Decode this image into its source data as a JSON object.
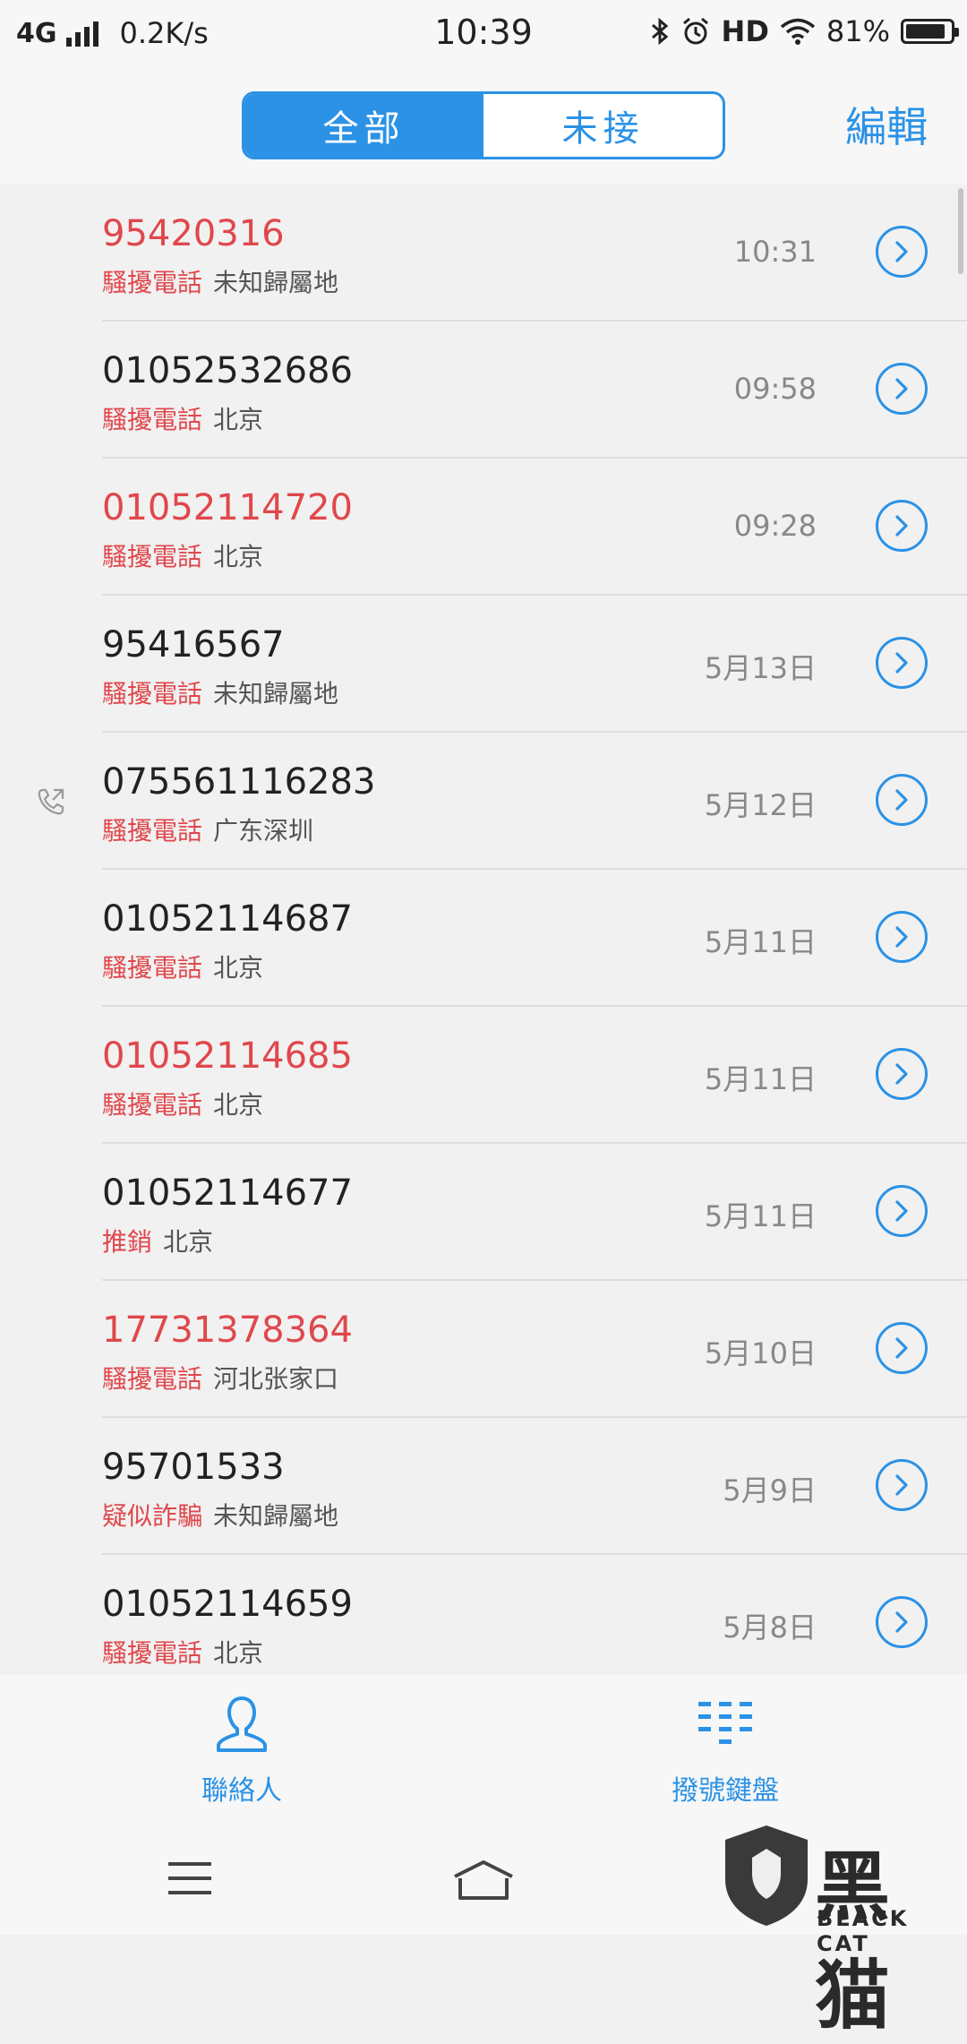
{
  "status_bar": {
    "network": "4G",
    "speed": "0.2K/s",
    "time": "10:39",
    "hd": "HD",
    "battery": "81%"
  },
  "header": {
    "tabs": [
      {
        "label": "全部",
        "active": true
      },
      {
        "label": "未接",
        "active": false
      }
    ],
    "edit_label": "編輯"
  },
  "calls": [
    {
      "number": "95420316",
      "missed": true,
      "tag": "騷擾電話",
      "location": "未知歸屬地",
      "time": "10:31",
      "outgoing": false
    },
    {
      "number": "01052532686",
      "missed": false,
      "tag": "騷擾電話",
      "location": "北京",
      "time": "09:58",
      "outgoing": false
    },
    {
      "number": "01052114720",
      "missed": true,
      "tag": "騷擾電話",
      "location": "北京",
      "time": "09:28",
      "outgoing": false
    },
    {
      "number": "95416567",
      "missed": false,
      "tag": "騷擾電話",
      "location": "未知歸屬地",
      "time": "5月13日",
      "outgoing": false
    },
    {
      "number": "075561116283",
      "missed": false,
      "tag": "騷擾電話",
      "location": "广东深圳",
      "time": "5月12日",
      "outgoing": true
    },
    {
      "number": "01052114687",
      "missed": false,
      "tag": "騷擾電話",
      "location": "北京",
      "time": "5月11日",
      "outgoing": false
    },
    {
      "number": "01052114685",
      "missed": true,
      "tag": "騷擾電話",
      "location": "北京",
      "time": "5月11日",
      "outgoing": false
    },
    {
      "number": "01052114677",
      "missed": false,
      "tag": "推銷",
      "location": "北京",
      "time": "5月11日",
      "outgoing": false
    },
    {
      "number": "17731378364",
      "missed": true,
      "tag": "騷擾電話",
      "location": "河北张家口",
      "time": "5月10日",
      "outgoing": false
    },
    {
      "number": "95701533",
      "missed": false,
      "tag": "疑似詐騙",
      "location": "未知歸屬地",
      "time": "5月9日",
      "outgoing": false
    },
    {
      "number": "01052114659",
      "missed": false,
      "tag": "騷擾電話",
      "location": "北京",
      "time": "5月8日",
      "outgoing": false
    }
  ],
  "bottom_tabs": [
    {
      "label": "聯絡人",
      "icon": "person-icon"
    },
    {
      "label": "撥號鍵盤",
      "icon": "dialpad-icon"
    }
  ],
  "watermark": {
    "text": "黑猫",
    "sub": "BLACK CAT"
  },
  "colors": {
    "accent": "#2b92e6",
    "missed": "#e0474c"
  }
}
